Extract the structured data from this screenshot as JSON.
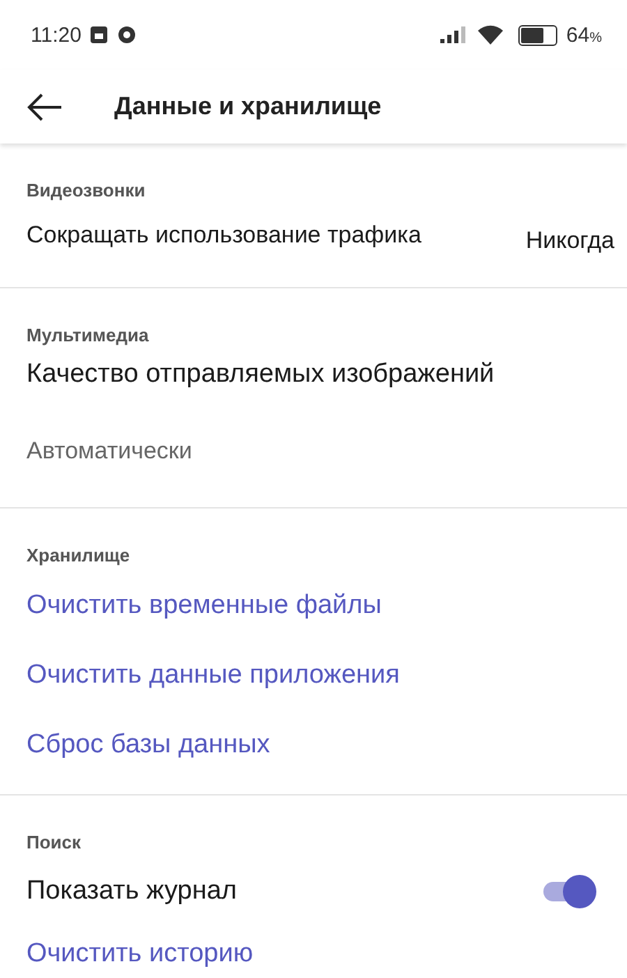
{
  "status_bar": {
    "time": "11:20",
    "battery_text": "64",
    "battery_unit": "%"
  },
  "header": {
    "title": "Данные и хранилище"
  },
  "sections": [
    {
      "title": "Видеозвонки",
      "items": [
        {
          "kind": "value",
          "label": "Сокращать использование трафика",
          "value": "Никогда"
        }
      ]
    },
    {
      "title": "Мультимедиа",
      "items": [
        {
          "kind": "stacked",
          "label": "Качество отправляемых изображений",
          "sub": "Автоматически"
        }
      ]
    },
    {
      "title": "Хранилище",
      "items": [
        {
          "kind": "link",
          "label": "Очистить временные файлы"
        },
        {
          "kind": "link",
          "label": "Очистить данные приложения"
        },
        {
          "kind": "link",
          "label": "Сброс базы данных"
        }
      ]
    },
    {
      "title": "Поиск",
      "items": [
        {
          "kind": "toggle",
          "label": "Показать журнал",
          "on": true
        },
        {
          "kind": "link",
          "label": "Очистить историю"
        }
      ]
    }
  ]
}
